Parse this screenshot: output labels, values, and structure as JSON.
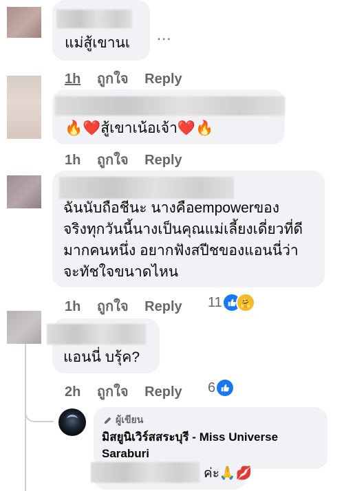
{
  "colors": {
    "bubble": "#f0f2f5",
    "secondary_text": "#65676b",
    "like_blue": "#1877f2",
    "thread_line": "#ced0d4"
  },
  "more_icon": "...",
  "comments": [
    {
      "text": "แม่สู้เขานเ",
      "time": "1h",
      "like_label": "ถูกใจ",
      "reply_label": "Reply"
    },
    {
      "text": "🔥❤️สู้เขาเน้อเจ้า❤️🔥",
      "time": "1h",
      "like_label": "ถูกใจ",
      "reply_label": "Reply"
    },
    {
      "lines": [
        "ฉันนับถือชีนะ นางคือempowerของ",
        "จริงทุกวันนี้นางเป็นคุณแม่เลี้ยงเดี่ยวที่ดี",
        "มากคนหนึ่ง อยากฟังสปีชของแอนนี่ว่า",
        "จะทัชใจขนาดไหน"
      ],
      "time": "1h",
      "like_label": "ถูกใจ",
      "reply_label": "Reply",
      "reaction_count": "11"
    },
    {
      "text": "แอนนี่ บรุ้ค?",
      "time": "2h",
      "like_label": "ถูกใจ",
      "reply_label": "Reply",
      "reaction_count": "6"
    }
  ],
  "reply": {
    "author_badge": "ผู้เขียน",
    "author_name_line1": "มิสยูนิเวิร์สสระบุรี - Miss Universe",
    "author_name_line2": "Saraburi",
    "text": "ค่ะ🙏💋"
  }
}
